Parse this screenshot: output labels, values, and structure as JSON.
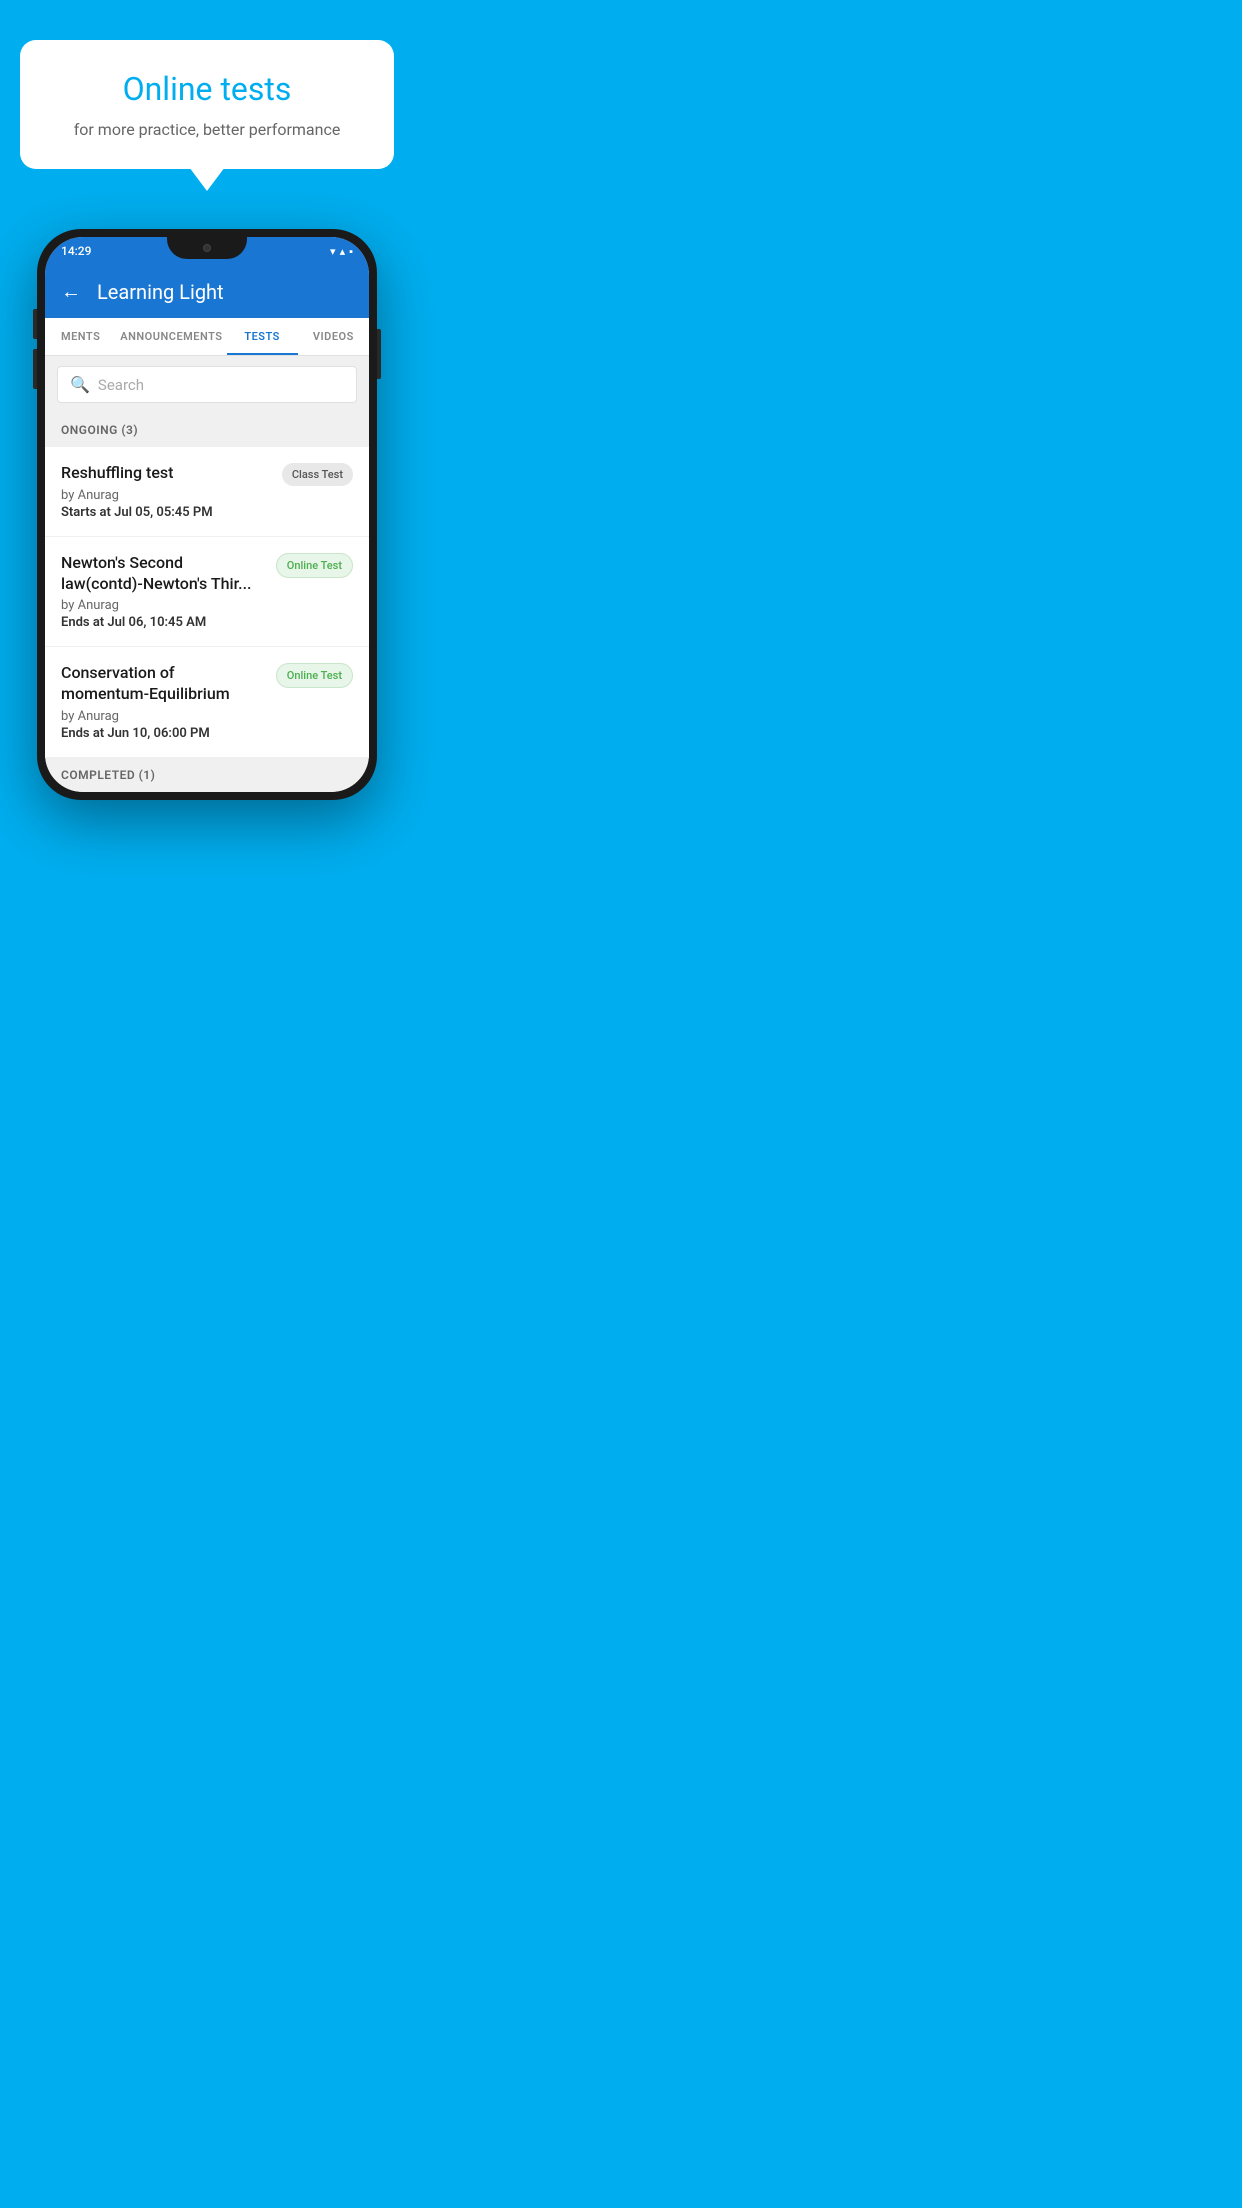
{
  "background": {
    "color": "#00AEEF"
  },
  "speech_bubble": {
    "title": "Online tests",
    "subtitle": "for more practice, better performance"
  },
  "phone": {
    "status_bar": {
      "time": "14:29",
      "icons": "▾◂▪"
    },
    "app_header": {
      "back_label": "←",
      "title": "Learning Light"
    },
    "tabs": [
      {
        "label": "MENTS",
        "active": false
      },
      {
        "label": "ANNOUNCEMENTS",
        "active": false
      },
      {
        "label": "TESTS",
        "active": true
      },
      {
        "label": "VIDEOS",
        "active": false
      }
    ],
    "search": {
      "placeholder": "Search"
    },
    "ongoing_section": {
      "label": "ONGOING (3)"
    },
    "tests": [
      {
        "name": "Reshuffling test",
        "by": "by Anurag",
        "date_label": "Starts at ",
        "date": "Jul 05, 05:45 PM",
        "badge": "Class Test",
        "badge_type": "class"
      },
      {
        "name": "Newton's Second law(contd)-Newton's Thir...",
        "by": "by Anurag",
        "date_label": "Ends at ",
        "date": "Jul 06, 10:45 AM",
        "badge": "Online Test",
        "badge_type": "online"
      },
      {
        "name": "Conservation of momentum-Equilibrium",
        "by": "by Anurag",
        "date_label": "Ends at ",
        "date": "Jun 10, 06:00 PM",
        "badge": "Online Test",
        "badge_type": "online"
      }
    ],
    "completed_section": {
      "label": "COMPLETED (1)"
    }
  }
}
